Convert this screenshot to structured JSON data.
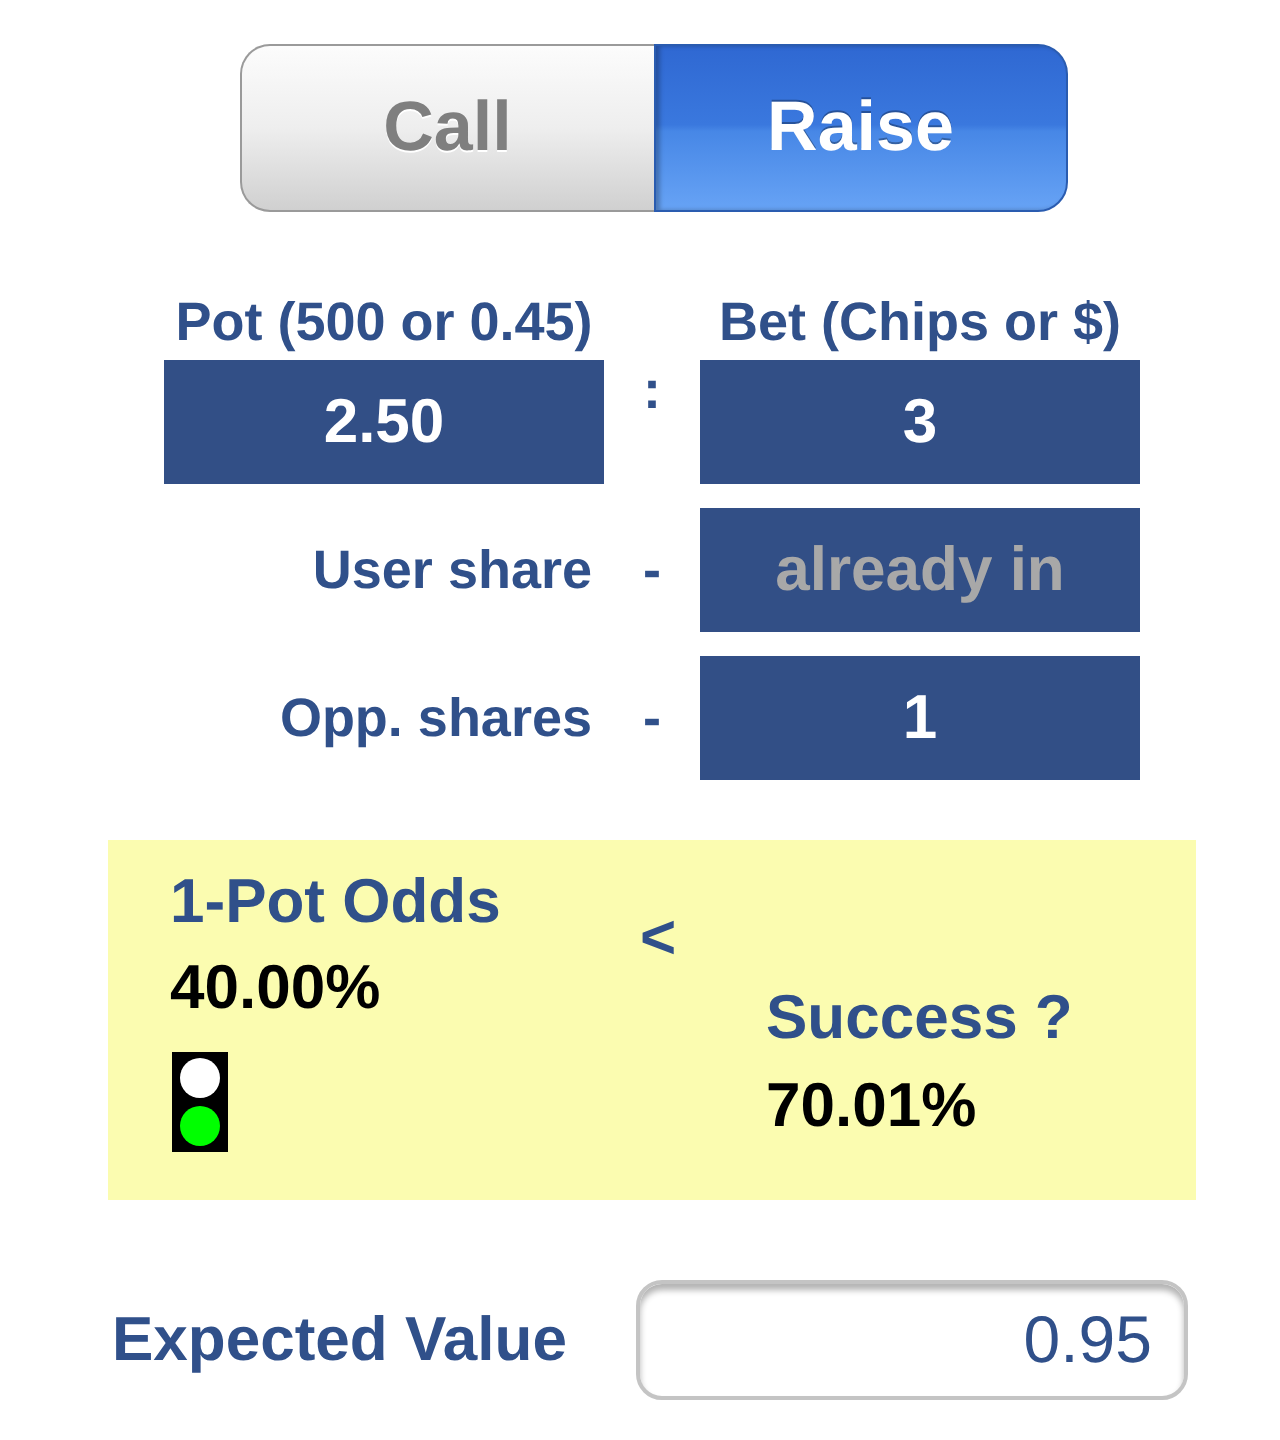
{
  "segments": [
    {
      "label": "Call",
      "selected": false
    },
    {
      "label": "Raise",
      "selected": true
    }
  ],
  "pot": {
    "label": "Pot (500 or 0.45)",
    "value": "2.50"
  },
  "ratio_separator": ":",
  "bet": {
    "label": "Bet (Chips or $)",
    "value": "3"
  },
  "shares": [
    {
      "label": "User share",
      "separator": "-",
      "placeholder": "already in"
    },
    {
      "label": "Opp. shares",
      "separator": "-",
      "value": "1"
    }
  ],
  "odds_panel": {
    "pot_odds": {
      "title": "1-Pot Odds",
      "value": "40.00%"
    },
    "traffic_light": {
      "lamps": [
        {
          "color": "#ffffff"
        },
        {
          "color": "#00ff00"
        }
      ]
    },
    "comparison": "<",
    "success": {
      "title": "Success ?",
      "value": "70.01%"
    }
  },
  "expected_value": {
    "label": "Expected Value",
    "value": "0.95"
  }
}
